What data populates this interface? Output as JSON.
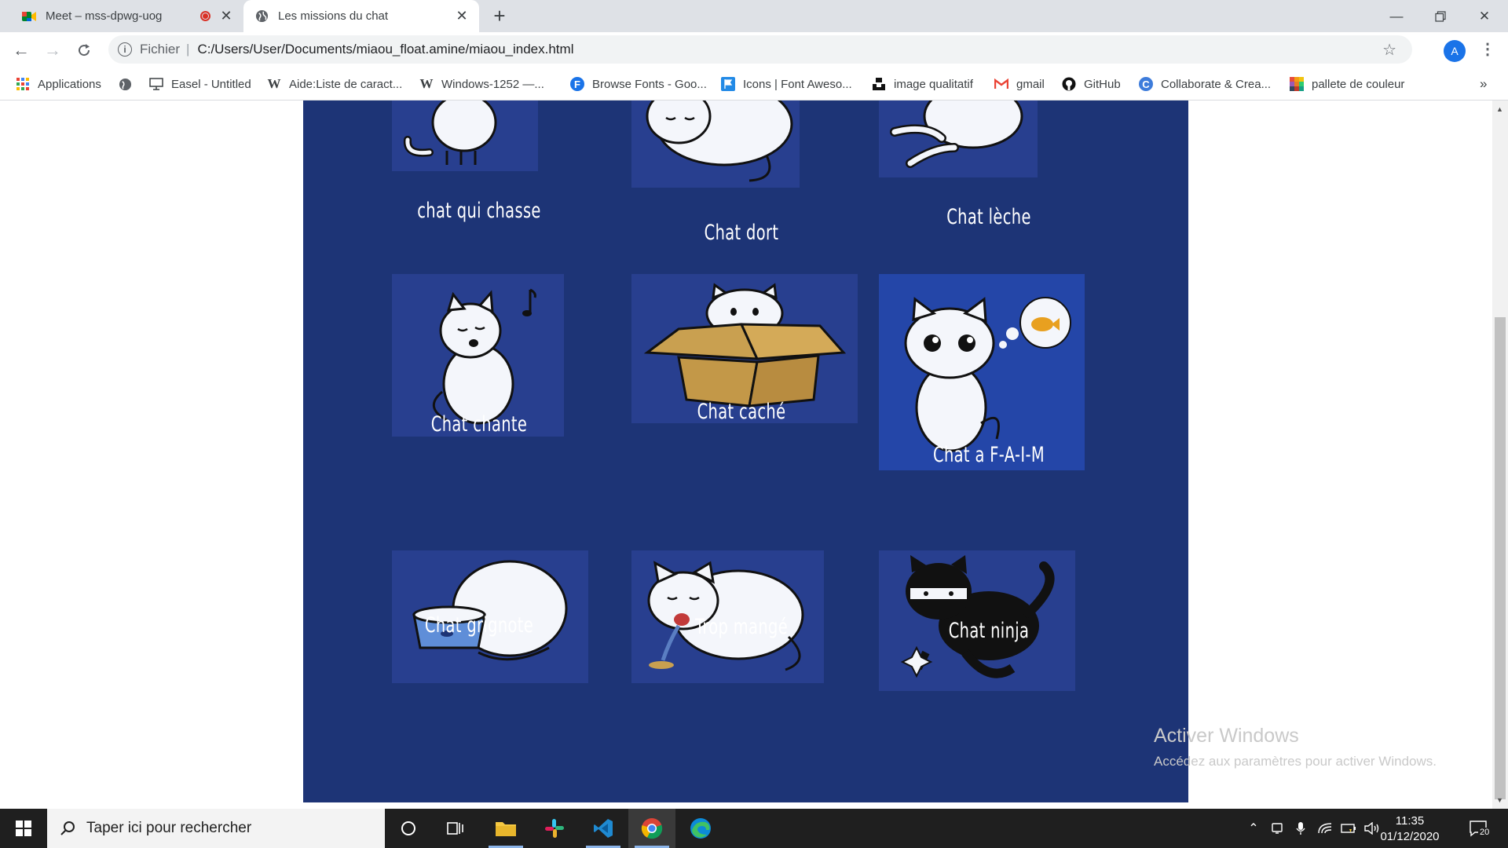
{
  "browser": {
    "tabs": [
      {
        "title": "Meet – mss-dpwg-uog",
        "icon": "google-meet-icon",
        "recording": true
      },
      {
        "title": "Les missions du chat",
        "icon": "globe-icon",
        "active": true
      }
    ],
    "address": {
      "scheme_label": "Fichier",
      "url": "C:/Users/User/Documents/miaou_float.amine/miaou_index.html"
    },
    "profile_initial": "A",
    "bookmarks": [
      {
        "label": "Applications",
        "icon": "apps-grid-icon"
      },
      {
        "label": "",
        "icon": "globe-icon"
      },
      {
        "label": "Easel - Untitled",
        "icon": "easel-icon"
      },
      {
        "label": "Aide:Liste de caract...",
        "icon": "wikipedia-icon"
      },
      {
        "label": "Windows-1252 —...",
        "icon": "wikipedia-icon"
      },
      {
        "label": "Browse Fonts - Goo...",
        "icon": "google-fonts-icon"
      },
      {
        "label": "Icons | Font Aweso...",
        "icon": "font-awesome-flag-icon"
      },
      {
        "label": "image qualitatif",
        "icon": "unsplash-icon"
      },
      {
        "label": "gmail",
        "icon": "gmail-icon"
      },
      {
        "label": "GitHub",
        "icon": "github-icon"
      },
      {
        "label": "Collaborate & Crea...",
        "icon": "canva-icon"
      },
      {
        "label": "pallete de couleur",
        "icon": "palette-icon"
      }
    ],
    "overflow": "»"
  },
  "page": {
    "cats": [
      {
        "caption": "chat qui chasse",
        "image": "cat-sitting-image"
      },
      {
        "caption": "Chat dort",
        "image": "cat-sleeping-image"
      },
      {
        "caption": "Chat lèche",
        "image": "cat-licking-image"
      },
      {
        "caption": "Chat chante",
        "image": "cat-singing-image"
      },
      {
        "caption": "Chat caché",
        "image": "cat-in-box-image"
      },
      {
        "caption": "Chat a F-A-I-M",
        "image": "cat-hungry-fish-image"
      },
      {
        "caption": "Chat grignote",
        "image": "cat-eating-bowl-image"
      },
      {
        "caption": "Trop mangé",
        "image": "cat-vomiting-image"
      },
      {
        "caption": "Chat ninja",
        "image": "cat-ninja-image"
      }
    ],
    "watermark": {
      "title": "Activer Windows",
      "subtitle": "Accédez aux paramètres pour activer Windows."
    }
  },
  "taskbar": {
    "search_placeholder": "Taper ici pour rechercher",
    "time": "11:35",
    "date": "01/12/2020",
    "notifications": "20"
  },
  "colors": {
    "page_panel": "#1d3476",
    "image_bg": "#283f8f",
    "taskbar": "#1f1f1f"
  }
}
